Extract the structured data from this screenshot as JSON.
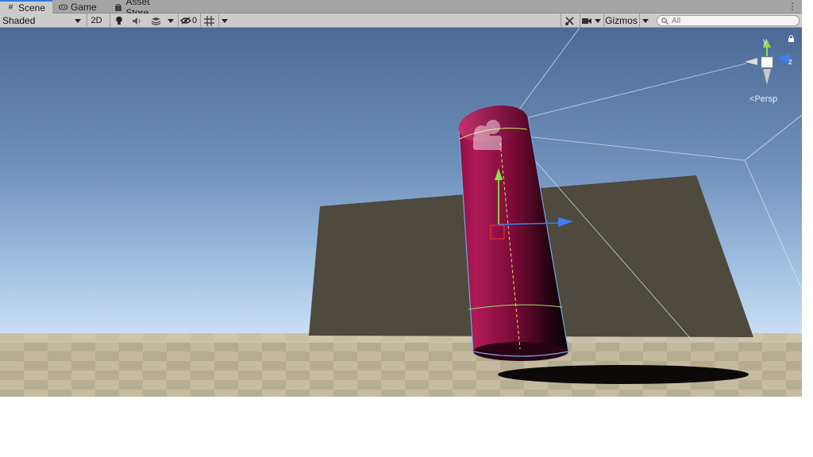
{
  "tabs": [
    {
      "label": "Scene",
      "icon": "grid-icon",
      "active": true
    },
    {
      "label": "Game",
      "icon": "gamepad-icon",
      "active": false
    },
    {
      "label": "Asset Store",
      "icon": "bag-icon",
      "active": false
    }
  ],
  "toolbar": {
    "shading_mode": "Shaded",
    "mode_2d": "2D",
    "hidden_count": "0",
    "gizmos": "Gizmos",
    "search_placeholder": "All"
  },
  "gizmo": {
    "axis_y": "y",
    "axis_z": "z",
    "projection": "Persp"
  },
  "colors": {
    "tab_active_accent": "#3a79d8",
    "sky_top": "#4c6a95",
    "sky_bottom": "#b7d3ee",
    "cylinder": "#a0134c",
    "wall": "#4e4a3e"
  }
}
